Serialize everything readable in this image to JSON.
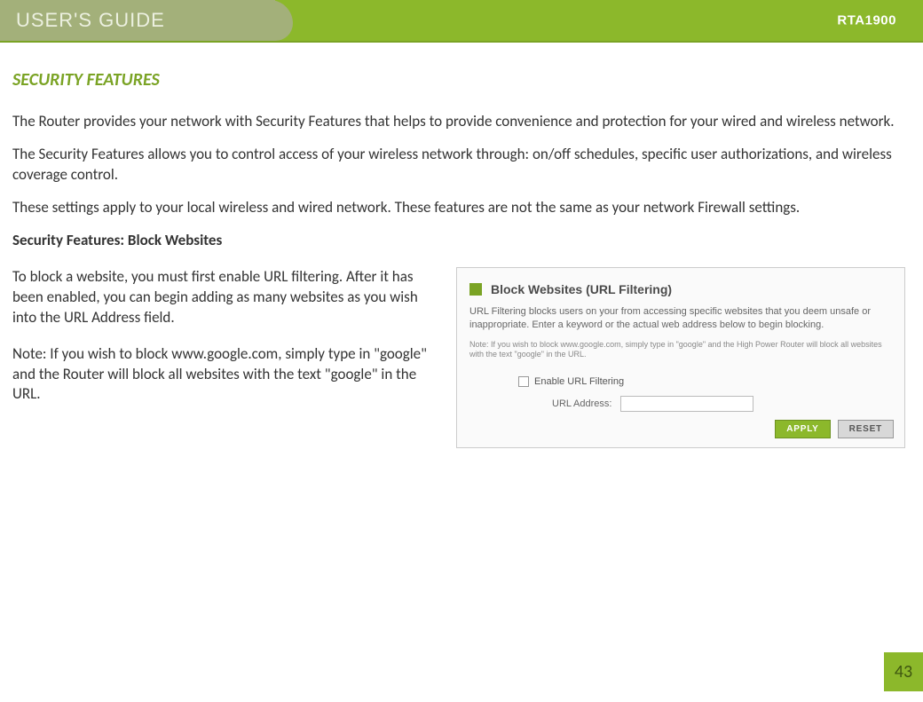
{
  "header": {
    "title": "USER'S GUIDE",
    "model": "RTA1900"
  },
  "section": {
    "title": "SECURITY FEATURES",
    "p1": "The Router provides your network with Security Features that helps to provide convenience and protection for your wired and wireless network.",
    "p2": "The Security Features allows you to control access of your wireless network through: on/off schedules, specific user authorizations, and wireless coverage control.",
    "p3": "These settings apply to your local wireless and wired network.  These features are not the same as your network Firewall settings.",
    "subheading": "Security Features: Block Websites",
    "left_p1": "To block a website, you must first enable URL filtering. After it has been enabled, you can begin adding as many websites as you wish into the URL Address field.",
    "left_p2": "Note:  If you wish to block www.google.com, simply type in \"google\" and the Router will block all websites with the text \"google\" in the URL."
  },
  "panel": {
    "title": "Block Websites (URL Filtering)",
    "desc": "URL Filtering blocks users on your from accessing specific websites that you deem unsafe or inappropriate. Enter a keyword or the actual web address below to begin blocking.",
    "note": "Note: If you wish to block www.google.com, simply type in \"google\" and the High Power Router will block all websites with the text \"google\" in the URL.",
    "enable_label": "Enable URL Filtering",
    "url_label": "URL Address:",
    "apply": "APPLY",
    "reset": "RESET"
  },
  "page_number": "43"
}
